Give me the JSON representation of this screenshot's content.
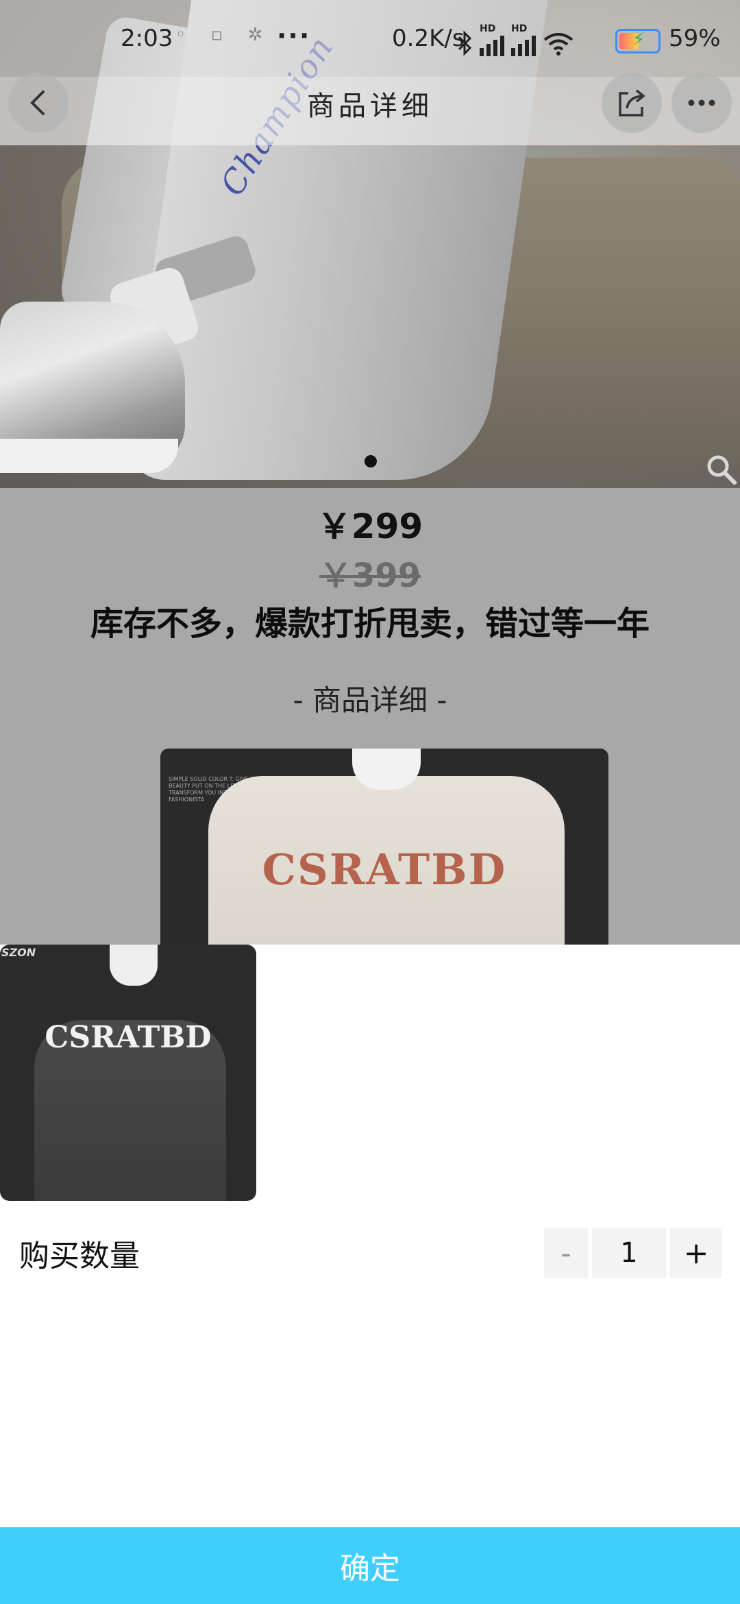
{
  "status_bar": {
    "time": "2:03",
    "notification_dots": "◦ ▫ ✲",
    "more": "···",
    "network_speed": "0.2K/s",
    "signal_label_1": "HD",
    "signal_label_2": "HD",
    "battery_percent": "59%"
  },
  "header": {
    "title": "商品详细",
    "icons": {
      "back": "chevron-left-icon",
      "share": "share-icon",
      "more": "more-icon"
    }
  },
  "product": {
    "price": "￥299",
    "original_price": "￥399",
    "headline": "库存不多，爆款打折甩卖，错过等一年",
    "section_title": "- 商品详细 -",
    "hero_brand_text": "Champion",
    "detail_print": "CSRATBD",
    "detail_small_text": "SIMPLE SOLID COLOR T. GIVE YOU A SIMPLE BEAUTY PUT ON THE LITTLE T TO TRANSFORM YOU INTO A STREET FASHIONISTA",
    "carousel_index": 1,
    "carousel_total": 1
  },
  "sheet": {
    "thumb_print": "CSRATBD",
    "thumb_logo": "SZON",
    "quantity_label": "购买数量",
    "minus": "-",
    "plus": "+",
    "quantity_value": "1",
    "confirm_label": "确定"
  },
  "colors": {
    "confirm": "#3ecfff",
    "overlay": "#a8a8a8",
    "battery_border": "#3d8bff"
  }
}
